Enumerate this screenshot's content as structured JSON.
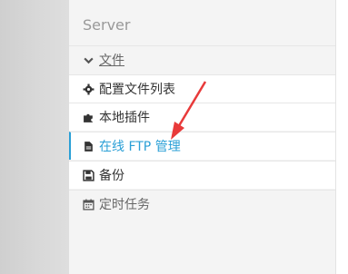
{
  "panel": {
    "title": "Server",
    "section_file": "文件",
    "items": [
      {
        "label": "配置文件列表"
      },
      {
        "label": "本地插件"
      },
      {
        "label": "在线 FTP 管理"
      },
      {
        "label": "备份"
      }
    ],
    "section_schedule": "定时任务"
  },
  "colors": {
    "accent": "#2a9fd6",
    "arrow": "#e83a3a"
  },
  "icons": {
    "file_section": "chevron-down-icon",
    "config": "gear-icon",
    "plugins": "puzzle-icon",
    "ftp": "file-icon",
    "backup": "save-icon",
    "schedule": "calendar-icon"
  }
}
